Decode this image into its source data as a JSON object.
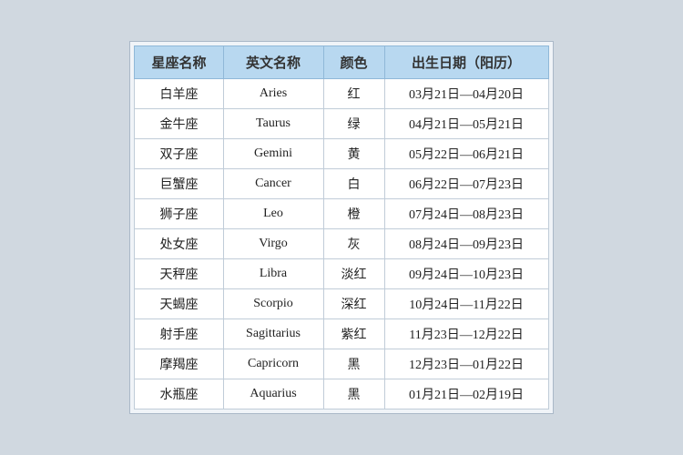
{
  "table": {
    "headers": {
      "zh_name": "星座名称",
      "en_name": "英文名称",
      "color": "颜色",
      "date_range": "出生日期（阳历）"
    },
    "rows": [
      {
        "zh": "白羊座",
        "en": "Aries",
        "color": "红",
        "date": "03月21日—04月20日"
      },
      {
        "zh": "金牛座",
        "en": "Taurus",
        "color": "绿",
        "date": "04月21日—05月21日"
      },
      {
        "zh": "双子座",
        "en": "Gemini",
        "color": "黄",
        "date": "05月22日—06月21日"
      },
      {
        "zh": "巨蟹座",
        "en": "Cancer",
        "color": "白",
        "date": "06月22日—07月23日"
      },
      {
        "zh": "狮子座",
        "en": "Leo",
        "color": "橙",
        "date": "07月24日—08月23日"
      },
      {
        "zh": "处女座",
        "en": "Virgo",
        "color": "灰",
        "date": "08月24日—09月23日"
      },
      {
        "zh": "天秤座",
        "en": "Libra",
        "color": "淡红",
        "date": "09月24日—10月23日"
      },
      {
        "zh": "天蝎座",
        "en": "Scorpio",
        "color": "深红",
        "date": "10月24日—11月22日"
      },
      {
        "zh": "射手座",
        "en": "Sagittarius",
        "color": "紫红",
        "date": "11月23日—12月22日"
      },
      {
        "zh": "摩羯座",
        "en": "Capricorn",
        "color": "黑",
        "date": "12月23日—01月22日"
      },
      {
        "zh": "水瓶座",
        "en": "Aquarius",
        "color": "黑",
        "date": "01月21日—02月19日"
      }
    ]
  }
}
